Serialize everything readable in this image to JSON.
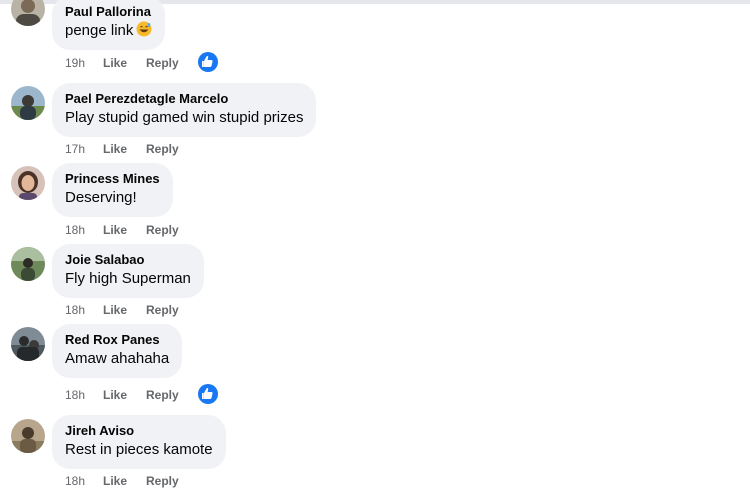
{
  "comments": [
    {
      "name": "Paul Pallorina",
      "text": "penge link",
      "emoji": "grinning-sweat-emoji",
      "time": "19h",
      "like": "Like",
      "reply": "Reply",
      "reaction": "like-reaction-icon"
    },
    {
      "name": "Pael Perezdetagle Marcelo",
      "text": "Play stupid gamed win stupid prizes",
      "time": "17h",
      "like": "Like",
      "reply": "Reply"
    },
    {
      "name": "Princess Mines",
      "text": "Deserving!",
      "time": "18h",
      "like": "Like",
      "reply": "Reply"
    },
    {
      "name": "Joie Salabao",
      "text": "Fly high Superman",
      "time": "18h",
      "like": "Like",
      "reply": "Reply"
    },
    {
      "name": "Red Rox Panes",
      "text": "Amaw ahahaha",
      "time": "18h",
      "like": "Like",
      "reply": "Reply",
      "reaction": "like-reaction-icon"
    },
    {
      "name": "Jireh Aviso",
      "text": "Rest in pieces kamote",
      "time": "18h",
      "like": "Like",
      "reply": "Reply"
    }
  ],
  "colors": {
    "bubble": "#f0f2f5",
    "meta_text": "#65676b",
    "like_blue": "#1877f2"
  }
}
